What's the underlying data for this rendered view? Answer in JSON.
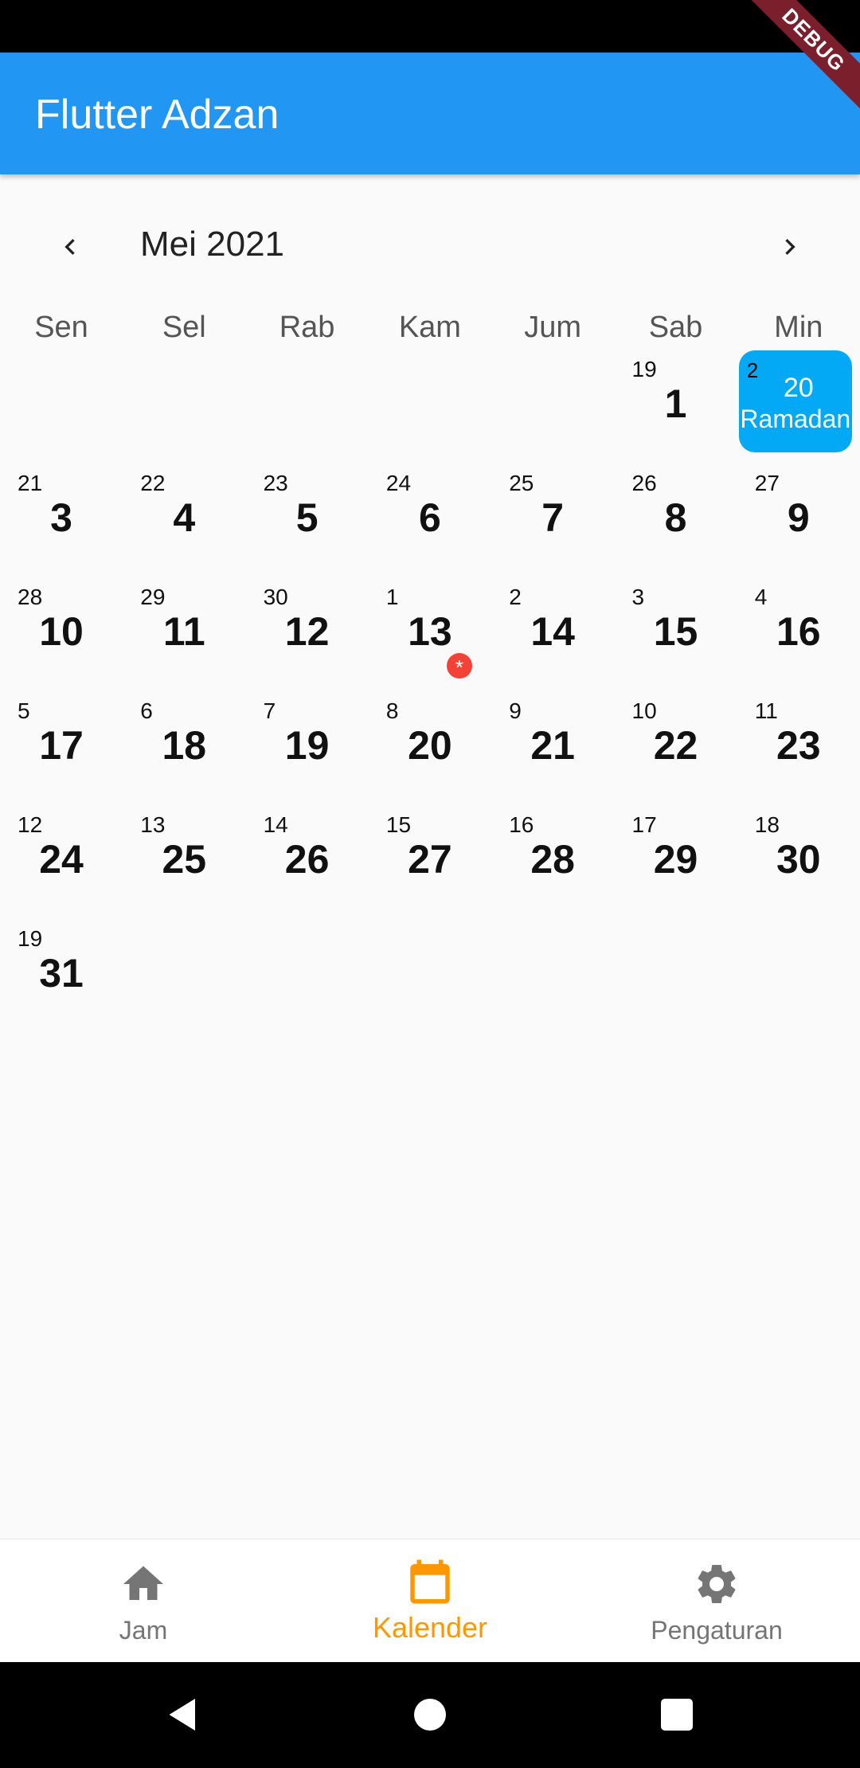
{
  "app": {
    "title": "Flutter Adzan",
    "debug_label": "DEBUG"
  },
  "calendar": {
    "month_title": "Mei 2021",
    "weekdays": [
      "Sen",
      "Sel",
      "Rab",
      "Kam",
      "Jum",
      "Sab",
      "Min"
    ],
    "weeks": [
      [
        null,
        null,
        null,
        null,
        null,
        {
          "greg": "1",
          "hijri": "19"
        },
        {
          "greg": "20",
          "hijri": "2",
          "selected": true,
          "event": "Ramadan"
        }
      ],
      [
        {
          "greg": "3",
          "hijri": "21"
        },
        {
          "greg": "4",
          "hijri": "22"
        },
        {
          "greg": "5",
          "hijri": "23"
        },
        {
          "greg": "6",
          "hijri": "24"
        },
        {
          "greg": "7",
          "hijri": "25"
        },
        {
          "greg": "8",
          "hijri": "26"
        },
        {
          "greg": "9",
          "hijri": "27"
        }
      ],
      [
        {
          "greg": "10",
          "hijri": "28"
        },
        {
          "greg": "11",
          "hijri": "29"
        },
        {
          "greg": "12",
          "hijri": "30"
        },
        {
          "greg": "13",
          "hijri": "1",
          "marker": "*"
        },
        {
          "greg": "14",
          "hijri": "2"
        },
        {
          "greg": "15",
          "hijri": "3"
        },
        {
          "greg": "16",
          "hijri": "4"
        }
      ],
      [
        {
          "greg": "17",
          "hijri": "5"
        },
        {
          "greg": "18",
          "hijri": "6"
        },
        {
          "greg": "19",
          "hijri": "7"
        },
        {
          "greg": "20",
          "hijri": "8"
        },
        {
          "greg": "21",
          "hijri": "9"
        },
        {
          "greg": "22",
          "hijri": "10"
        },
        {
          "greg": "23",
          "hijri": "11"
        }
      ],
      [
        {
          "greg": "24",
          "hijri": "12"
        },
        {
          "greg": "25",
          "hijri": "13"
        },
        {
          "greg": "26",
          "hijri": "14"
        },
        {
          "greg": "27",
          "hijri": "15"
        },
        {
          "greg": "28",
          "hijri": "16"
        },
        {
          "greg": "29",
          "hijri": "17"
        },
        {
          "greg": "30",
          "hijri": "18"
        }
      ],
      [
        {
          "greg": "31",
          "hijri": "19"
        },
        null,
        null,
        null,
        null,
        null,
        null
      ]
    ]
  },
  "bottom_nav": {
    "items": [
      {
        "label": "Jam",
        "icon": "home-icon",
        "active": false
      },
      {
        "label": "Kalender",
        "icon": "calendar-icon",
        "active": true
      },
      {
        "label": "Pengaturan",
        "icon": "gear-icon",
        "active": false
      }
    ]
  },
  "colors": {
    "app_bar": "#2196f3",
    "selected_day": "#03a9f4",
    "active_tab": "#ff9800",
    "event_marker": "#f44336"
  }
}
